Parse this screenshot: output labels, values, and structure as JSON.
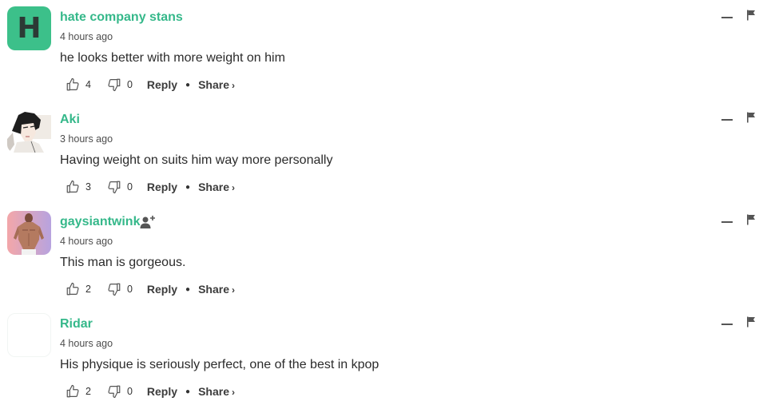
{
  "comments": [
    {
      "username": "hate company stans",
      "avatar_letter": "H",
      "timestamp": "4 hours ago",
      "text": "he looks better with more weight on him",
      "likes": "4",
      "dislikes": "0",
      "reply_label": "Reply",
      "share_label": "Share",
      "share_arrow": "›"
    },
    {
      "username": "Aki",
      "timestamp": "3 hours ago",
      "text": "Having weight on suits him way more personally",
      "likes": "3",
      "dislikes": "0",
      "reply_label": "Reply",
      "share_label": "Share",
      "share_arrow": "›"
    },
    {
      "username": "gaysiantwink",
      "timestamp": "4 hours ago",
      "text": "This man is gorgeous.",
      "likes": "2",
      "dislikes": "0",
      "reply_label": "Reply",
      "share_label": "Share",
      "share_arrow": "›"
    },
    {
      "username": "Ridar",
      "timestamp": "4 hours ago",
      "text": "His physique is seriously perfect, one of the best in kpop",
      "likes": "2",
      "dislikes": "0",
      "reply_label": "Reply",
      "share_label": "Share",
      "share_arrow": "›"
    }
  ],
  "icons": {
    "like": "thumbs-up-icon",
    "dislike": "thumbs-down-icon",
    "collapse": "minus-icon",
    "flag": "flag-icon",
    "follow": "add-user-icon"
  },
  "colors": {
    "username": "#35b88a",
    "avatar_letter_bg": "#3cc08a",
    "text": "#2b2b2b"
  }
}
